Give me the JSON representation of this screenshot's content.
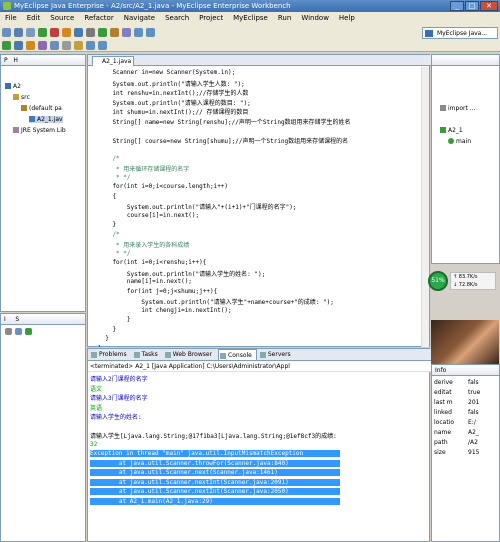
{
  "window": {
    "title": "MyEclipse Java Enterprise - A2/src/A2_1.java - MyEclipse Enterprise Workbench",
    "controls": [
      "_",
      "□",
      "✕"
    ]
  },
  "menu": [
    "File",
    "Edit",
    "Source",
    "Refactor",
    "Navigate",
    "Search",
    "Project",
    "MyEclipse",
    "Run",
    "Window",
    "Help"
  ],
  "perspective": "MyEclipse Java...",
  "left_top": {
    "tabs": [
      "P",
      "H"
    ],
    "tree": [
      "A2",
      "src",
      "(default pa",
      "A2_1.jav",
      "JRE System Lib"
    ]
  },
  "left_bot": {
    "tabs": [
      "I",
      "S"
    ]
  },
  "editor": {
    "tab": "A2_1.java",
    "lines": [
      {
        "text": "    Scanner in=new Scanner(System.in);",
        "color": "#000"
      },
      {
        "text": "    System.out.println(\"请输入学生人数: \");",
        "color": "#000"
      },
      {
        "text": "    int renshu=in.nextInt();//存储学生的人数",
        "color": "#000"
      },
      {
        "text": "    System.out.println(\"请输入课程的数目: \");",
        "color": "#000"
      },
      {
        "text": "    int shumu=in.nextInt();// 存储课程的数目",
        "color": "#000"
      },
      {
        "text": "    String[] name=new String[renshu];//声明一个String数组用来存储学生的姓名",
        "color": "#000"
      },
      {
        "text": "",
        "color": "#000"
      },
      {
        "text": "    String[] course=new String[shumu];//声明一个String数组用来存储课程的名",
        "color": "#000"
      },
      {
        "text": "",
        "color": "#000"
      },
      {
        "text": "    /*",
        "color": "#3f7f5f"
      },
      {
        "text": "     * 用来循环存储课程的名字",
        "color": "#3f7f5f"
      },
      {
        "text": "     * */",
        "color": "#3f7f5f"
      },
      {
        "text": "    for(int i=0;i<course.length;i++)",
        "color": "#000"
      },
      {
        "text": "    {",
        "color": "#000"
      },
      {
        "text": "        System.out.println(\"请输入\"+(i+1)+\"门课程的名字\");",
        "color": "#000"
      },
      {
        "text": "        course[i]=in.next();",
        "color": "#000"
      },
      {
        "text": "    }",
        "color": "#000"
      },
      {
        "text": "    /*",
        "color": "#3f7f5f"
      },
      {
        "text": "     * 用来录入学生的各科成绩",
        "color": "#3f7f5f"
      },
      {
        "text": "     * */",
        "color": "#3f7f5f"
      },
      {
        "text": "    for(int i=0;i<renshu;i++){",
        "color": "#000"
      },
      {
        "text": "        System.out.println(\"请输入学生的姓名: \");",
        "color": "#000"
      },
      {
        "text": "        name[i]=in.next();",
        "color": "#000"
      },
      {
        "text": "        for(int j=0;j<shumu;j++){",
        "color": "#000"
      },
      {
        "text": "            System.out.println(\"请输入学生\"+name+course+\"的成绩: \");",
        "color": "#000"
      },
      {
        "text": "            int chengji=in.nextInt();",
        "color": "#000"
      },
      {
        "text": "        }",
        "color": "#000"
      },
      {
        "text": "    }",
        "color": "#000"
      },
      {
        "text": "  }",
        "color": "#000"
      },
      {
        "text": "}",
        "color": "#000"
      }
    ]
  },
  "console": {
    "tabs": [
      "Problems",
      "Tasks",
      "Web Browser",
      "Console",
      "Servers"
    ],
    "active_tab": "Console",
    "terminated": "<terminated> A2_1 [Java Application] C:\\Users\\Administrator\\Appl",
    "lines": [
      {
        "text": "请输入2门课程的名字",
        "color": "#0000c0",
        "sel": false
      },
      {
        "text": "语文",
        "color": "#00a000",
        "sel": false
      },
      {
        "text": "请输入3门课程的名字",
        "color": "#0000c0",
        "sel": false
      },
      {
        "text": "英语",
        "color": "#00a000",
        "sel": false
      },
      {
        "text": "请输入学生的姓名: ",
        "color": "#0000c0",
        "sel": false
      },
      {
        "text": "",
        "color": "#000",
        "sel": false
      },
      {
        "text": "请输入学生[Ljava.lang.String;@17f1ba3[Ljava.lang.String;@1ef8cf3的成绩: ",
        "color": "#000",
        "sel": false
      },
      {
        "text": "32",
        "color": "#00a000",
        "sel": false
      },
      {
        "text": "Exception in thread \"main\" java.util.InputMismatchException",
        "color": "#fff",
        "sel": true
      },
      {
        "text": "        at java.util.Scanner.throwFor(Scanner.java:840)",
        "color": "#fff",
        "sel": true
      },
      {
        "text": "        at java.util.Scanner.next(Scanner.java:1461)",
        "color": "#fff",
        "sel": true
      },
      {
        "text": "        at java.util.Scanner.nextInt(Scanner.java:2091)",
        "color": "#fff",
        "sel": true
      },
      {
        "text": "        at java.util.Scanner.nextInt(Scanner.java:2050)",
        "color": "#fff",
        "sel": true
      },
      {
        "text": "        at A2_1.main(A2_1.java:29)",
        "color": "#fff",
        "sel": true
      }
    ]
  },
  "outline": {
    "items": [
      "import ...",
      "A2_1",
      "main"
    ]
  },
  "network": {
    "percent": "51%",
    "up": "83.7K/s",
    "down": "72.8K/s"
  },
  "properties": {
    "header": "Info",
    "rows": [
      {
        "k": "derive",
        "v": "fals"
      },
      {
        "k": "editat",
        "v": "true"
      },
      {
        "k": "last m",
        "v": "201"
      },
      {
        "k": "linked",
        "v": "fals"
      },
      {
        "k": "locatio",
        "v": "E:/"
      },
      {
        "k": "name",
        "v": "A2_"
      },
      {
        "k": "path",
        "v": "/A2"
      },
      {
        "k": "size",
        "v": "915"
      }
    ]
  }
}
